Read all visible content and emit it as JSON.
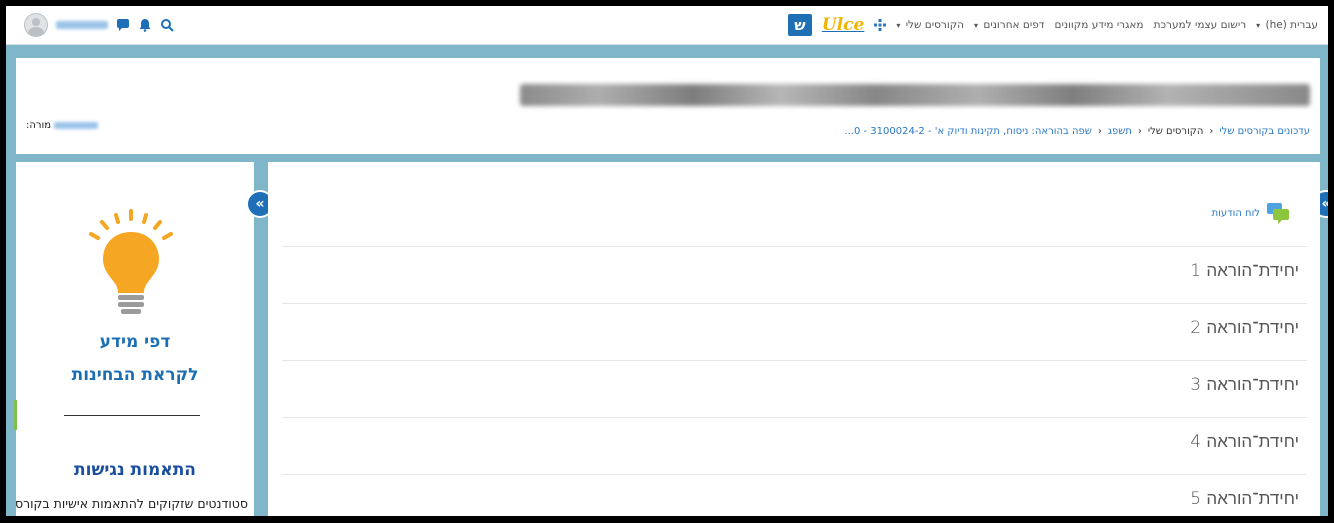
{
  "navbar": {
    "brand_letter": "ש",
    "brand_name": "Ulce",
    "menu": [
      {
        "label": "הקורסים שלי",
        "has_caret": true
      },
      {
        "label": "דפים אחרונים",
        "has_caret": true
      },
      {
        "label": "מאגרי מידע מקוונים",
        "has_caret": false
      },
      {
        "label": "רישום עצמי למערכת",
        "has_caret": false
      },
      {
        "label": "עברית (he)",
        "has_caret": true
      }
    ],
    "caret": "▾",
    "icons": [
      "avatar-icon",
      "chat-icon",
      "bell-icon",
      "search-icon",
      "grid-icon"
    ]
  },
  "header": {
    "breadcrumb": [
      {
        "label": "עדכונים בקורסים שלי"
      },
      {
        "label": "הקורסים שלי"
      },
      {
        "label": "תשפג"
      },
      {
        "label": "שפה בהוראה: ניסוח, תקינות ודיוק א' - 3100024-2 - 0..."
      }
    ],
    "breadcrumb_sep": "‹",
    "teacher_label": "מורה:"
  },
  "left_block": {
    "title_line1": "דפי מידע",
    "title_line2": "לקראת הבחינות",
    "access_title": "התאמות נגישות",
    "access_text": "סטודנטים שזקוקים להתאמות אישיות בקורס",
    "bulb_color": "#f5a623"
  },
  "main": {
    "forum_link": "לוח הודעות",
    "sections": [
      {
        "label": "יחידת־הוראה 1"
      },
      {
        "label": "יחידת־הוראה 2"
      },
      {
        "label": "יחידת־הוראה 3"
      },
      {
        "label": "יחידת־הוראה 4"
      },
      {
        "label": "יחידת־הוראה 5"
      }
    ]
  },
  "drawer_toggle_glyph": "«",
  "colors": {
    "accent": "#1e6fb8",
    "background": "#7fb6c9",
    "link": "#2a78c4"
  }
}
